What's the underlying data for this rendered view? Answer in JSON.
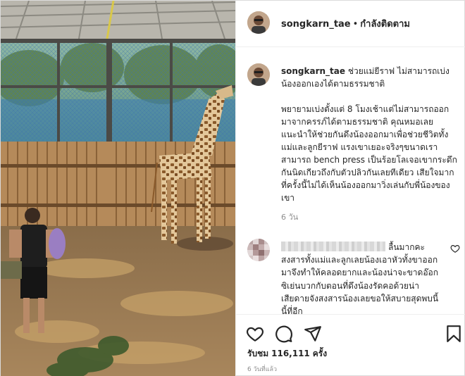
{
  "post": {
    "username": "songkarn_tae",
    "separator": "•",
    "follow_status": "กำลังติดตาม"
  },
  "caption": {
    "username": "songkarn_tae",
    "first_line": "ช่วยแม่ยีราฟ ไม่สามารถเบ่งน้องออกเองได้ตามธรรมชาติ",
    "body": "พยายามเบ่งตั้งแต่ 8 โมงเช้าแต่ไม่สามารถออกมาจากครรภ์ได้ตามธรรมชาติ คุณหมอเลยแนะนำให้ช่วยกันดึงน้องออกมาเพื่อช่วยชีวิตทั้งแม่และลูกยีราฟ แรงเขาเยอะจริงๆขนาดเราสามารถ bench press เป็นร้อยโลเจอเขากระดึกกันนิดเกียวถึงกับตัวปลิวกันเลยทีเดียว เสียใจมากที่ครั้งนี้ไม่ได้เห็นน้องออกมาวิ่งเล่นกับพี่น้องของเขา",
    "time": "6 วัน"
  },
  "comment": {
    "text": "ลื้นมากคะสงสารทั้งแม่และลูกเลยน้องเอาหัวทั้งขาออกมาจึงทำให้คลอดยากและน้องน่าจะขาดอ๊อกซิเย่นบวกกับตอนที่ดึงน้องรัดคอด้วยน่าเสียดายจังสงสารน้องเลยขอให้สบายสุดพบนี้นี้ที่อีก"
  },
  "actions": {
    "icons": [
      "heart-icon",
      "comment-icon",
      "share-icon",
      "bookmark-icon"
    ],
    "likes_label": "รับชม",
    "likes_count": "116,111",
    "likes_unit": "ครั้ง",
    "timestamp": "6 วันที่แล้ว"
  }
}
